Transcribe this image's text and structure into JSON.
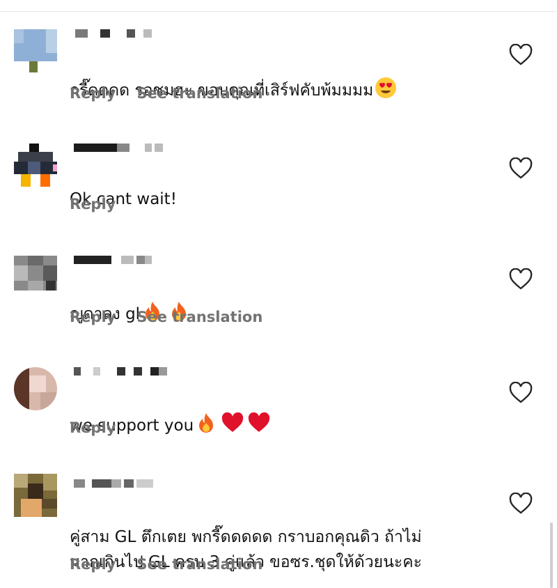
{
  "comments": [
    {
      "text": "กรี๊ดดดด รอชมฮะ ขอบคุณที่เสิร์ฟคับพ้มมมม",
      "emojis": [
        "heart-eyes"
      ],
      "reply_label": "Reply",
      "translate_label": "See translation"
    },
    {
      "text": "Ok cant wait!",
      "emojis": [],
      "reply_label": "Reply",
      "translate_label": ""
    },
    {
      "text": "ญูดาลง gl",
      "emojis": [
        "fire",
        "fire"
      ],
      "reply_label": "Reply",
      "translate_label": "See translation"
    },
    {
      "text": "we support you",
      "emojis": [
        "fire",
        "red-heart",
        "red-heart"
      ],
      "reply_label": "Reply",
      "translate_label": ""
    },
    {
      "text": "คู่สาม GL ตึกเตย พกรี๊ดดดดด กราบอกคุณดิว ถ้าไม่\nมากเกินไป GL ครบ 3 คู่แล้ว ขอซร.ชุดให้ด้วยนะคะ",
      "emojis": [],
      "reply_label": "Reply",
      "translate_label": "See translation"
    }
  ],
  "icons": {
    "like": "heart-outline-icon"
  },
  "colors": {
    "text": "#121212",
    "secondary": "#737373",
    "fire": "#f2611d",
    "heart": "#e0112b",
    "emoji_face": "#ffc93a"
  }
}
